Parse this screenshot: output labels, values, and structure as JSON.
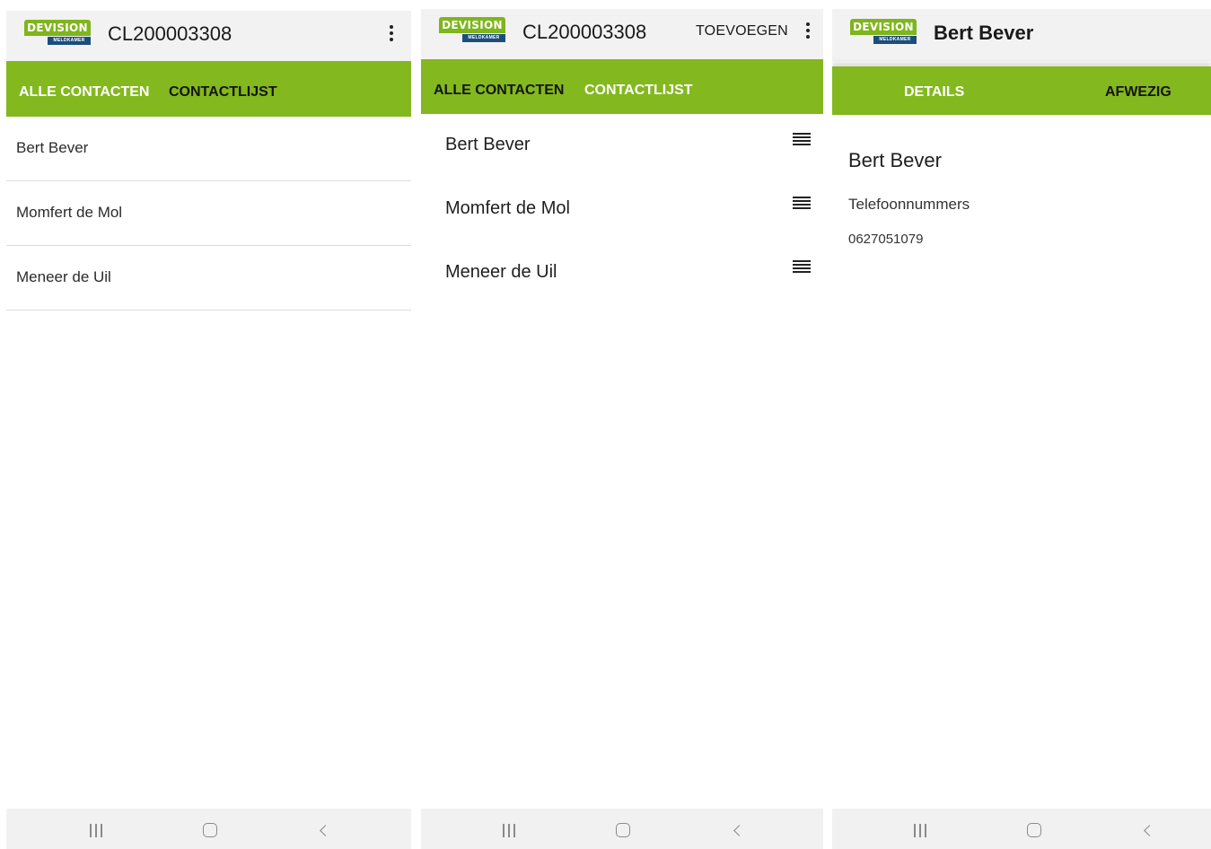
{
  "brand": {
    "logo_text": "DEVISION",
    "logo_subtext": "MELDKAMER",
    "accent_color": "#83b81e",
    "appbar_color": "#f2f2f2",
    "logo_blue": "#1c4e7a"
  },
  "screen1": {
    "title": "CL200003308",
    "tabs": [
      "ALLE CONTACTEN",
      "CONTACTLIJST"
    ],
    "active_tab": "ALLE CONTACTEN",
    "contacts": [
      "Bert Bever",
      "Momfert de Mol",
      "Meneer de Uil"
    ]
  },
  "screen2": {
    "title": "CL200003308",
    "add_label": "TOEVOEGEN",
    "tabs": [
      "ALLE CONTACTEN",
      "CONTACTLIJST"
    ],
    "active_tab": "CONTACTLIJST",
    "contacts": [
      "Bert Bever",
      "Momfert de Mol",
      "Meneer de Uil"
    ]
  },
  "screen3": {
    "title": "Bert Bever",
    "tabs": [
      "DETAILS",
      "AFWEZIG"
    ],
    "active_tab": "DETAILS",
    "contact_name": "Bert Bever",
    "phones_label": "Telefoonnummers",
    "phone": "0627051079"
  },
  "navbar": {
    "buttons": [
      "recents-icon",
      "home-icon",
      "back-icon"
    ]
  }
}
